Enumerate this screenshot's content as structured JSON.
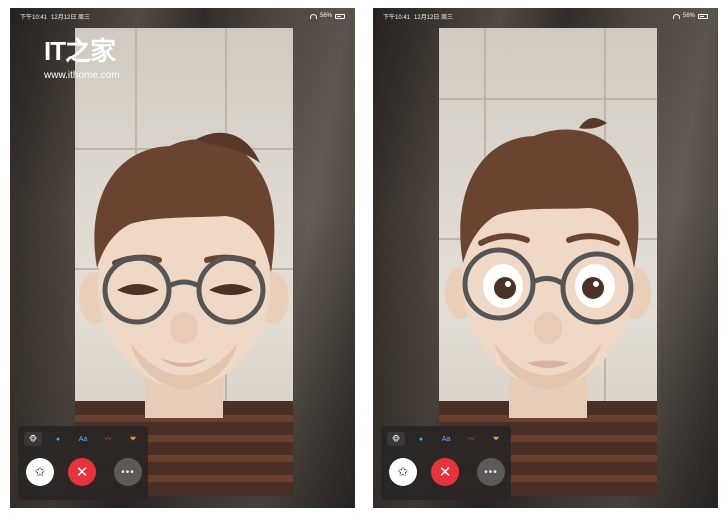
{
  "watermark": {
    "logo": "IT之家",
    "url": "www.ithome.com"
  },
  "screens": [
    {
      "status": {
        "time": "下午10:41",
        "date": "12月12日 周三",
        "battery": "56%"
      },
      "effects": [
        "memoji",
        "filters",
        "text",
        "shapes",
        "stickers"
      ],
      "effect_glyphs": [
        "🐵",
        "●",
        "Aa",
        "〰",
        "❤"
      ],
      "buttons": {
        "star": "✩",
        "end": "✕",
        "more": "•••"
      }
    },
    {
      "status": {
        "time": "下午10:41",
        "date": "12月12日 周三",
        "battery": "56%"
      },
      "effects": [
        "memoji",
        "filters",
        "text",
        "shapes",
        "stickers"
      ],
      "effect_glyphs": [
        "🐵",
        "●",
        "Aa",
        "〰",
        "❤"
      ],
      "buttons": {
        "star": "✩",
        "end": "✕",
        "more": "•••"
      }
    }
  ],
  "colors": {
    "end_call": "#e8323c",
    "control_panel": "#282624",
    "hair": "#6b4331",
    "skin": "#efd9c6",
    "sweater": "#4a2f24"
  }
}
